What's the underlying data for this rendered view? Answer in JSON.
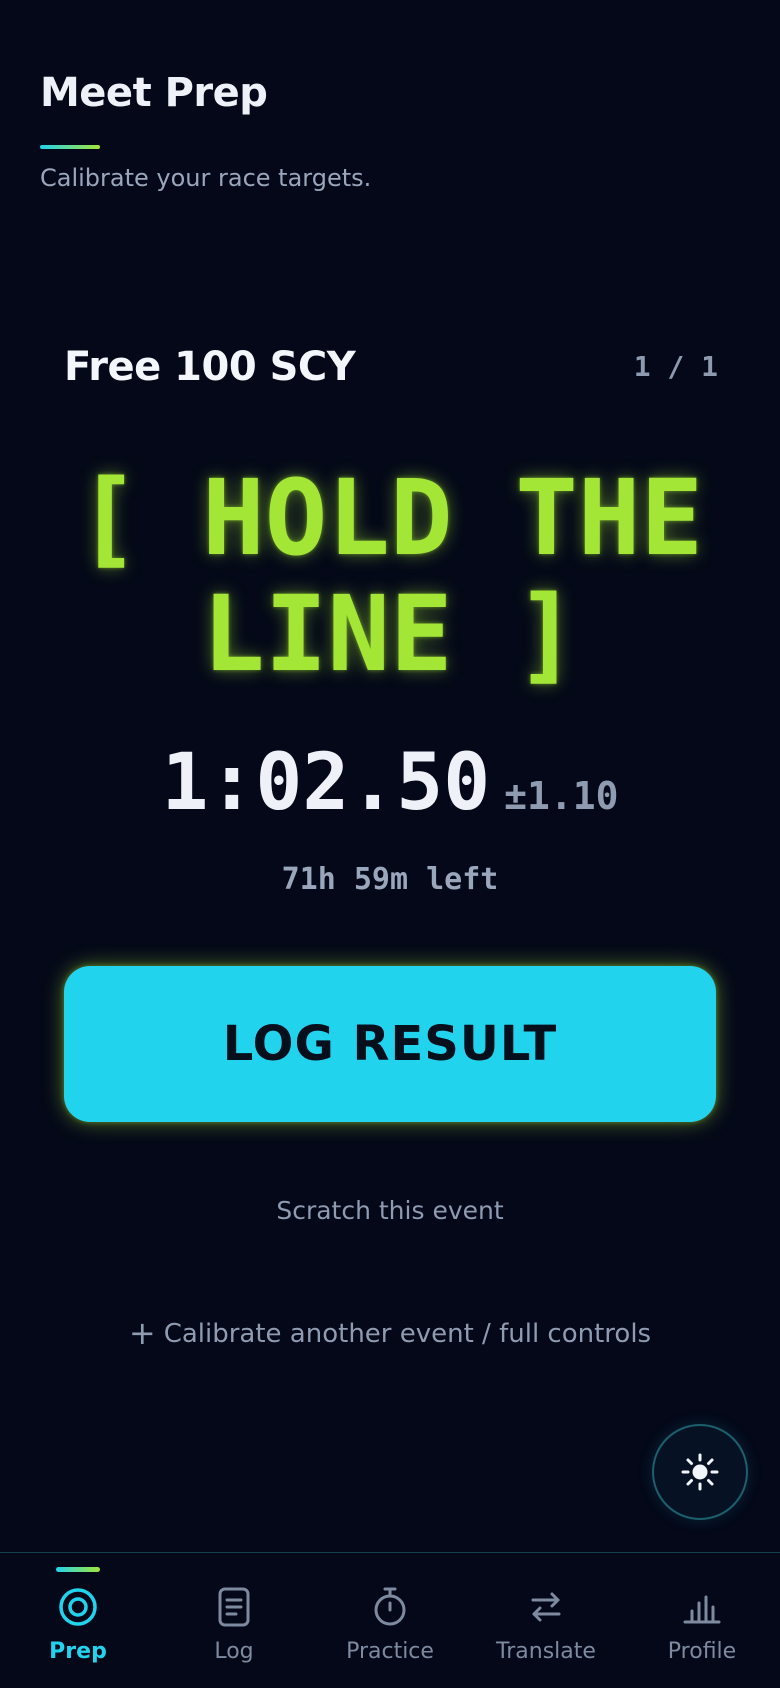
{
  "header": {
    "title": "Meet Prep",
    "subtitle": "Calibrate your race targets."
  },
  "event": {
    "name": "Free 100 SCY",
    "counter": "1 / 1",
    "headline_line1": "[ HOLD THE",
    "headline_line2": "LINE ]",
    "target_time": "1:02.50",
    "tolerance": "±1.10",
    "time_left": "71h 59m left"
  },
  "actions": {
    "log_result": "LOG RESULT",
    "scratch": "Scratch this event",
    "calibrate_plus": "+",
    "calibrate": "Calibrate another event / full controls"
  },
  "theme_toggle": {
    "icon": "sun-icon"
  },
  "tabbar": {
    "active_tab": "Prep",
    "items": [
      {
        "label": "Prep",
        "icon": "target-icon"
      },
      {
        "label": "Log",
        "icon": "document-icon"
      },
      {
        "label": "Practice",
        "icon": "stopwatch-icon"
      },
      {
        "label": "Translate",
        "icon": "swap-arrows-icon"
      },
      {
        "label": "Profile",
        "icon": "bar-chart-icon"
      }
    ]
  },
  "colors": {
    "background": "#040818",
    "accent_cyan": "#22d3ee",
    "accent_lime": "#a3e635",
    "muted_text": "#8f9bb1"
  }
}
